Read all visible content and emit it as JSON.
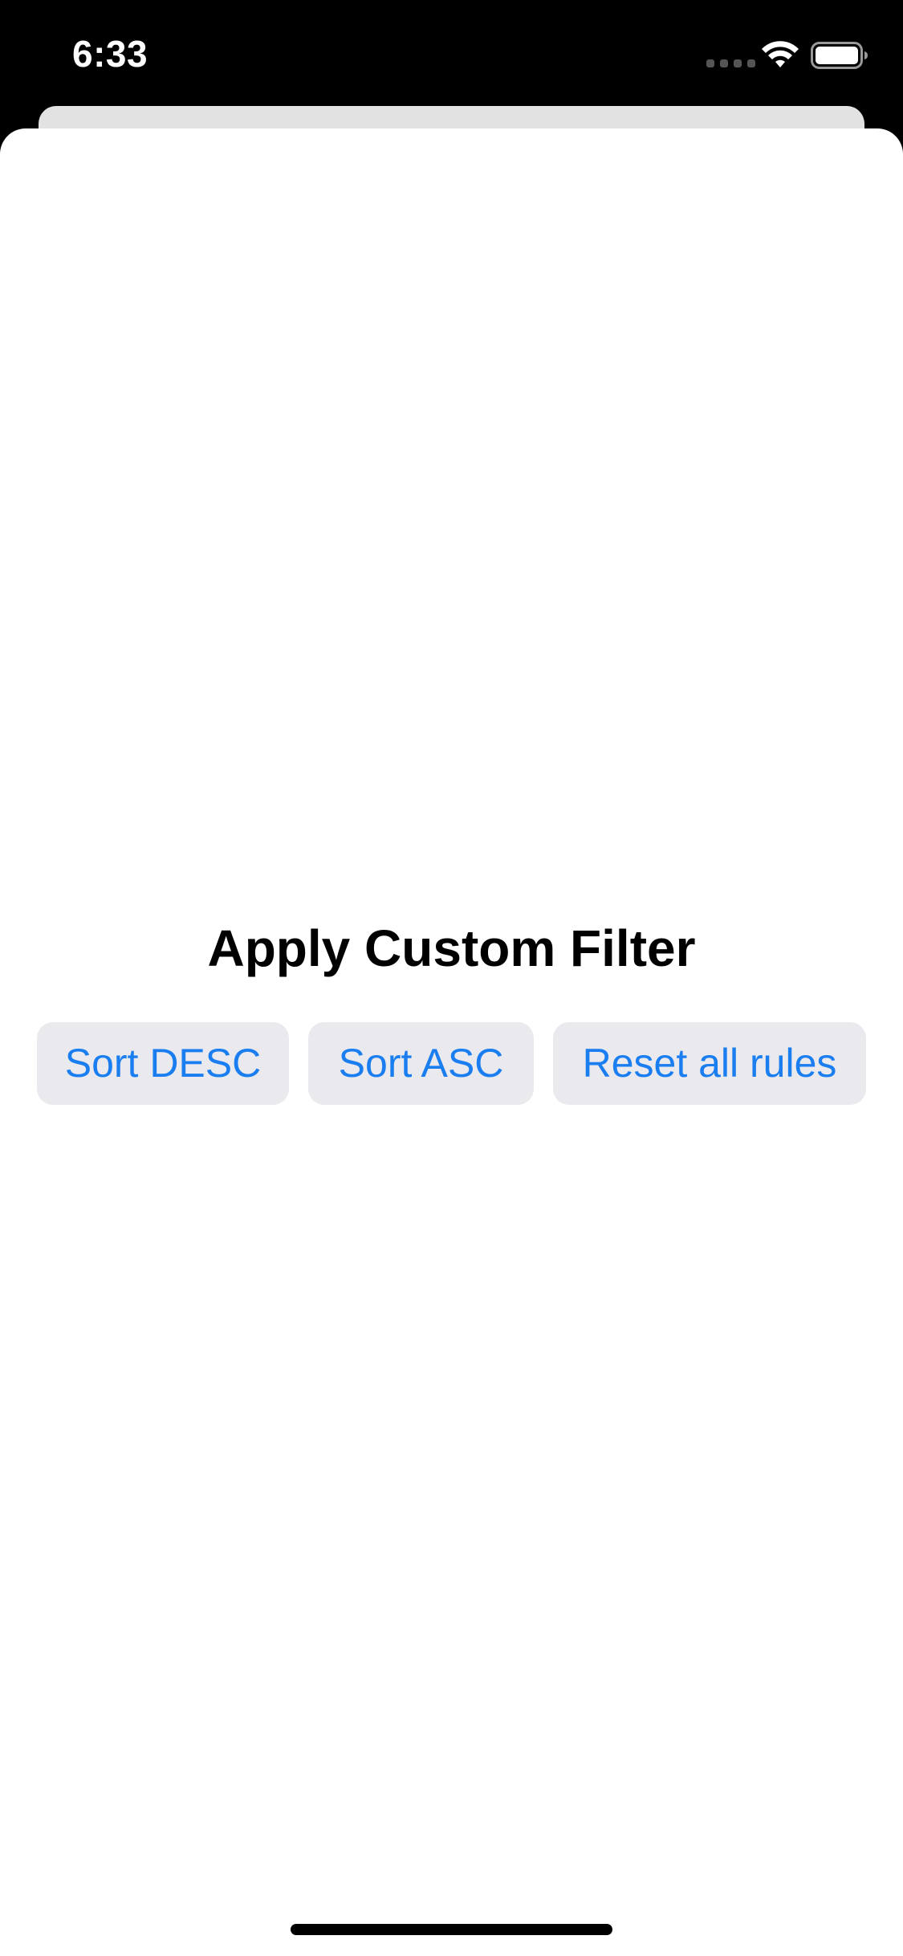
{
  "status_bar": {
    "time": "6:33",
    "icons": [
      "cellular-signal-icon",
      "wifi-icon",
      "battery-icon"
    ]
  },
  "screen": {
    "title": "Apply Custom Filter",
    "buttons": {
      "sort_desc": "Sort DESC",
      "sort_asc": "Sort ASC",
      "reset_rules": "Reset all rules"
    }
  },
  "colors": {
    "accent": "#1a7ef0",
    "button_bg": "#e9e9ee",
    "sheet_bg": "#ffffff",
    "status_bar_bg": "#000000"
  }
}
